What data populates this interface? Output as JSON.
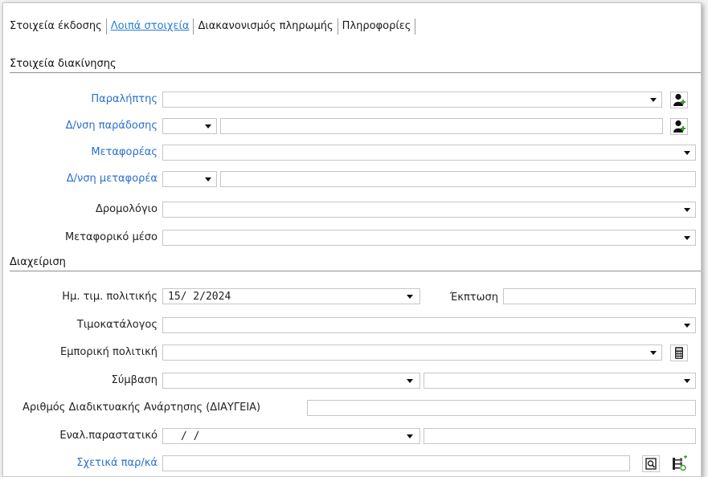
{
  "tabs": [
    "Στοιχεία έκδοσης",
    "Λοιπά στοιχεία",
    "Διακανονισμός πληρωμής",
    "Πληροφορίες"
  ],
  "sections": {
    "transport": "Στοιχεία διακίνησης",
    "management": "Διαχείριση"
  },
  "fields": {
    "recipient": "Παραλήπτης",
    "delivery_address": "Δ/νση παράδοσης",
    "carrier": "Μεταφορέας",
    "carrier_address": "Δ/νση μεταφορέα",
    "route": "Δρομολόγιο",
    "vehicle": "Μεταφορικό μέσο",
    "price_policy_date": "Ημ. τιμ. πολιτικής",
    "price_policy_date_value": "15/ 2/2024",
    "discount": "Έκπτωση",
    "price_list": "Τιμοκατάλογος",
    "commercial_policy": "Εμπορική πολιτική",
    "contract": "Σύμβαση",
    "diavgeia": "Αριθμός Διαδικτυακής Ανάρτησης (ΔΙΑΥΓΕΙΑ)",
    "alt_document": "Εναλ.παραστατικό",
    "alt_document_value": "/   /",
    "related_docs": "Σχετικά παρ/κά"
  },
  "icons": {
    "add_user": "user-add-icon",
    "calculator": "calculator-icon",
    "search_doc": "document-search-icon",
    "tree": "tree-add-icon",
    "accent_add": "#3c9a2e"
  }
}
